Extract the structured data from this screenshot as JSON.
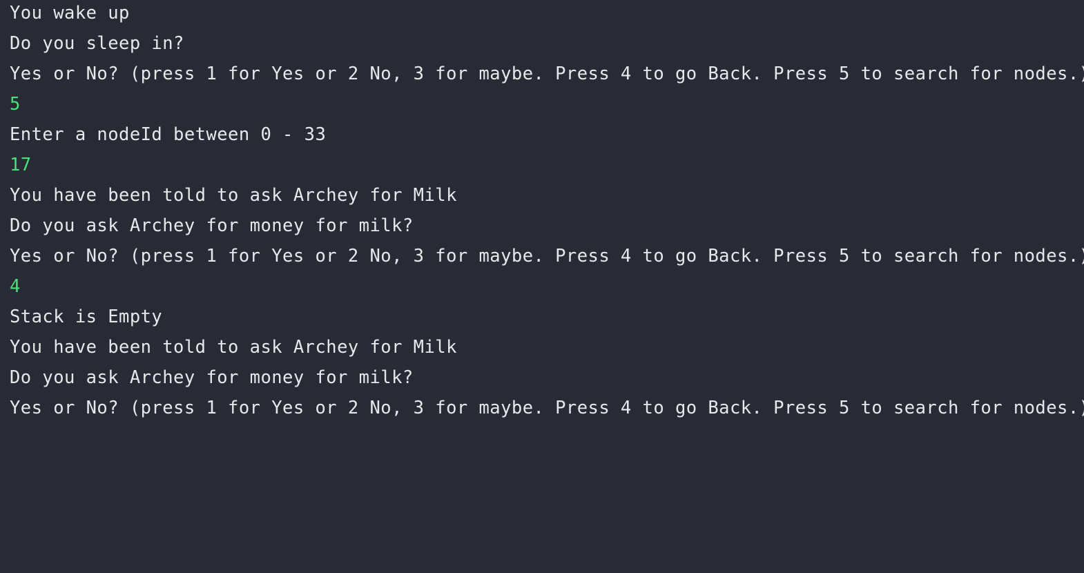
{
  "colors": {
    "background": "#282a36",
    "output_text": "#e8e8ec",
    "user_input_text": "#4be07a"
  },
  "console": {
    "lines": [
      {
        "text": "You wake up",
        "kind": "output"
      },
      {
        "text": "Do you sleep in?",
        "kind": "output"
      },
      {
        "text": "Yes or No? (press 1 for Yes or 2 No, 3 for maybe. Press 4 to go Back. Press 5 to search for nodes.)",
        "kind": "output"
      },
      {
        "text": "5",
        "kind": "input"
      },
      {
        "text": "Enter a nodeId between 0 - 33",
        "kind": "output"
      },
      {
        "text": "17",
        "kind": "input"
      },
      {
        "text": "You have been told to ask Archey for Milk",
        "kind": "output"
      },
      {
        "text": "Do you ask Archey for money for milk?",
        "kind": "output"
      },
      {
        "text": "Yes or No? (press 1 for Yes or 2 No, 3 for maybe. Press 4 to go Back. Press 5 to search for nodes.)",
        "kind": "output"
      },
      {
        "text": "4",
        "kind": "input"
      },
      {
        "text": "Stack is Empty",
        "kind": "output"
      },
      {
        "text": "You have been told to ask Archey for Milk",
        "kind": "output"
      },
      {
        "text": "Do you ask Archey for money for milk?",
        "kind": "output"
      },
      {
        "text": "Yes or No? (press 1 for Yes or 2 No, 3 for maybe. Press 4 to go Back. Press 5 to search for nodes.)",
        "kind": "output"
      }
    ]
  }
}
